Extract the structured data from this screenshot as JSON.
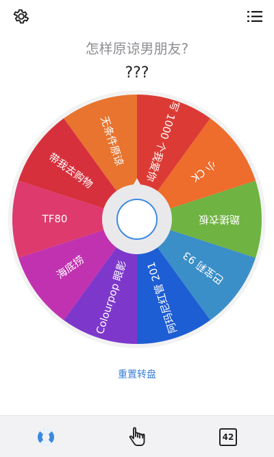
{
  "header": {
    "settings_icon": "gear-icon",
    "list_icon": "list-icon"
  },
  "question": "怎样原谅男朋友?",
  "result": "???",
  "wheel": {
    "segments": [
      {
        "label": "无条件原谅",
        "color": "#e8742f"
      },
      {
        "label": "写 1000 个我爱你",
        "color": "#dc3b35"
      },
      {
        "label": "小 CK",
        "color": "#ee6c2c"
      },
      {
        "label": "跪搓衣板",
        "color": "#6fb342"
      },
      {
        "label": "巴宝莉 93",
        "color": "#3b8fc8"
      },
      {
        "label": "阿玛尼红管 201",
        "color": "#1e5ed4"
      },
      {
        "label": "Colourpop 眼影",
        "color": "#7d38cb"
      },
      {
        "label": "海底捞",
        "color": "#c132b0"
      },
      {
        "label": "TF80",
        "color": "#de3a6e"
      },
      {
        "label": "带我去购物",
        "color": "#d6303c"
      }
    ],
    "center_icon": "spin-button"
  },
  "reset_label": "重置转盘",
  "bottom_nav": {
    "lifebuoy_icon": "lifebuoy-icon",
    "tap_icon": "tap-hand-icon",
    "count": "42"
  }
}
